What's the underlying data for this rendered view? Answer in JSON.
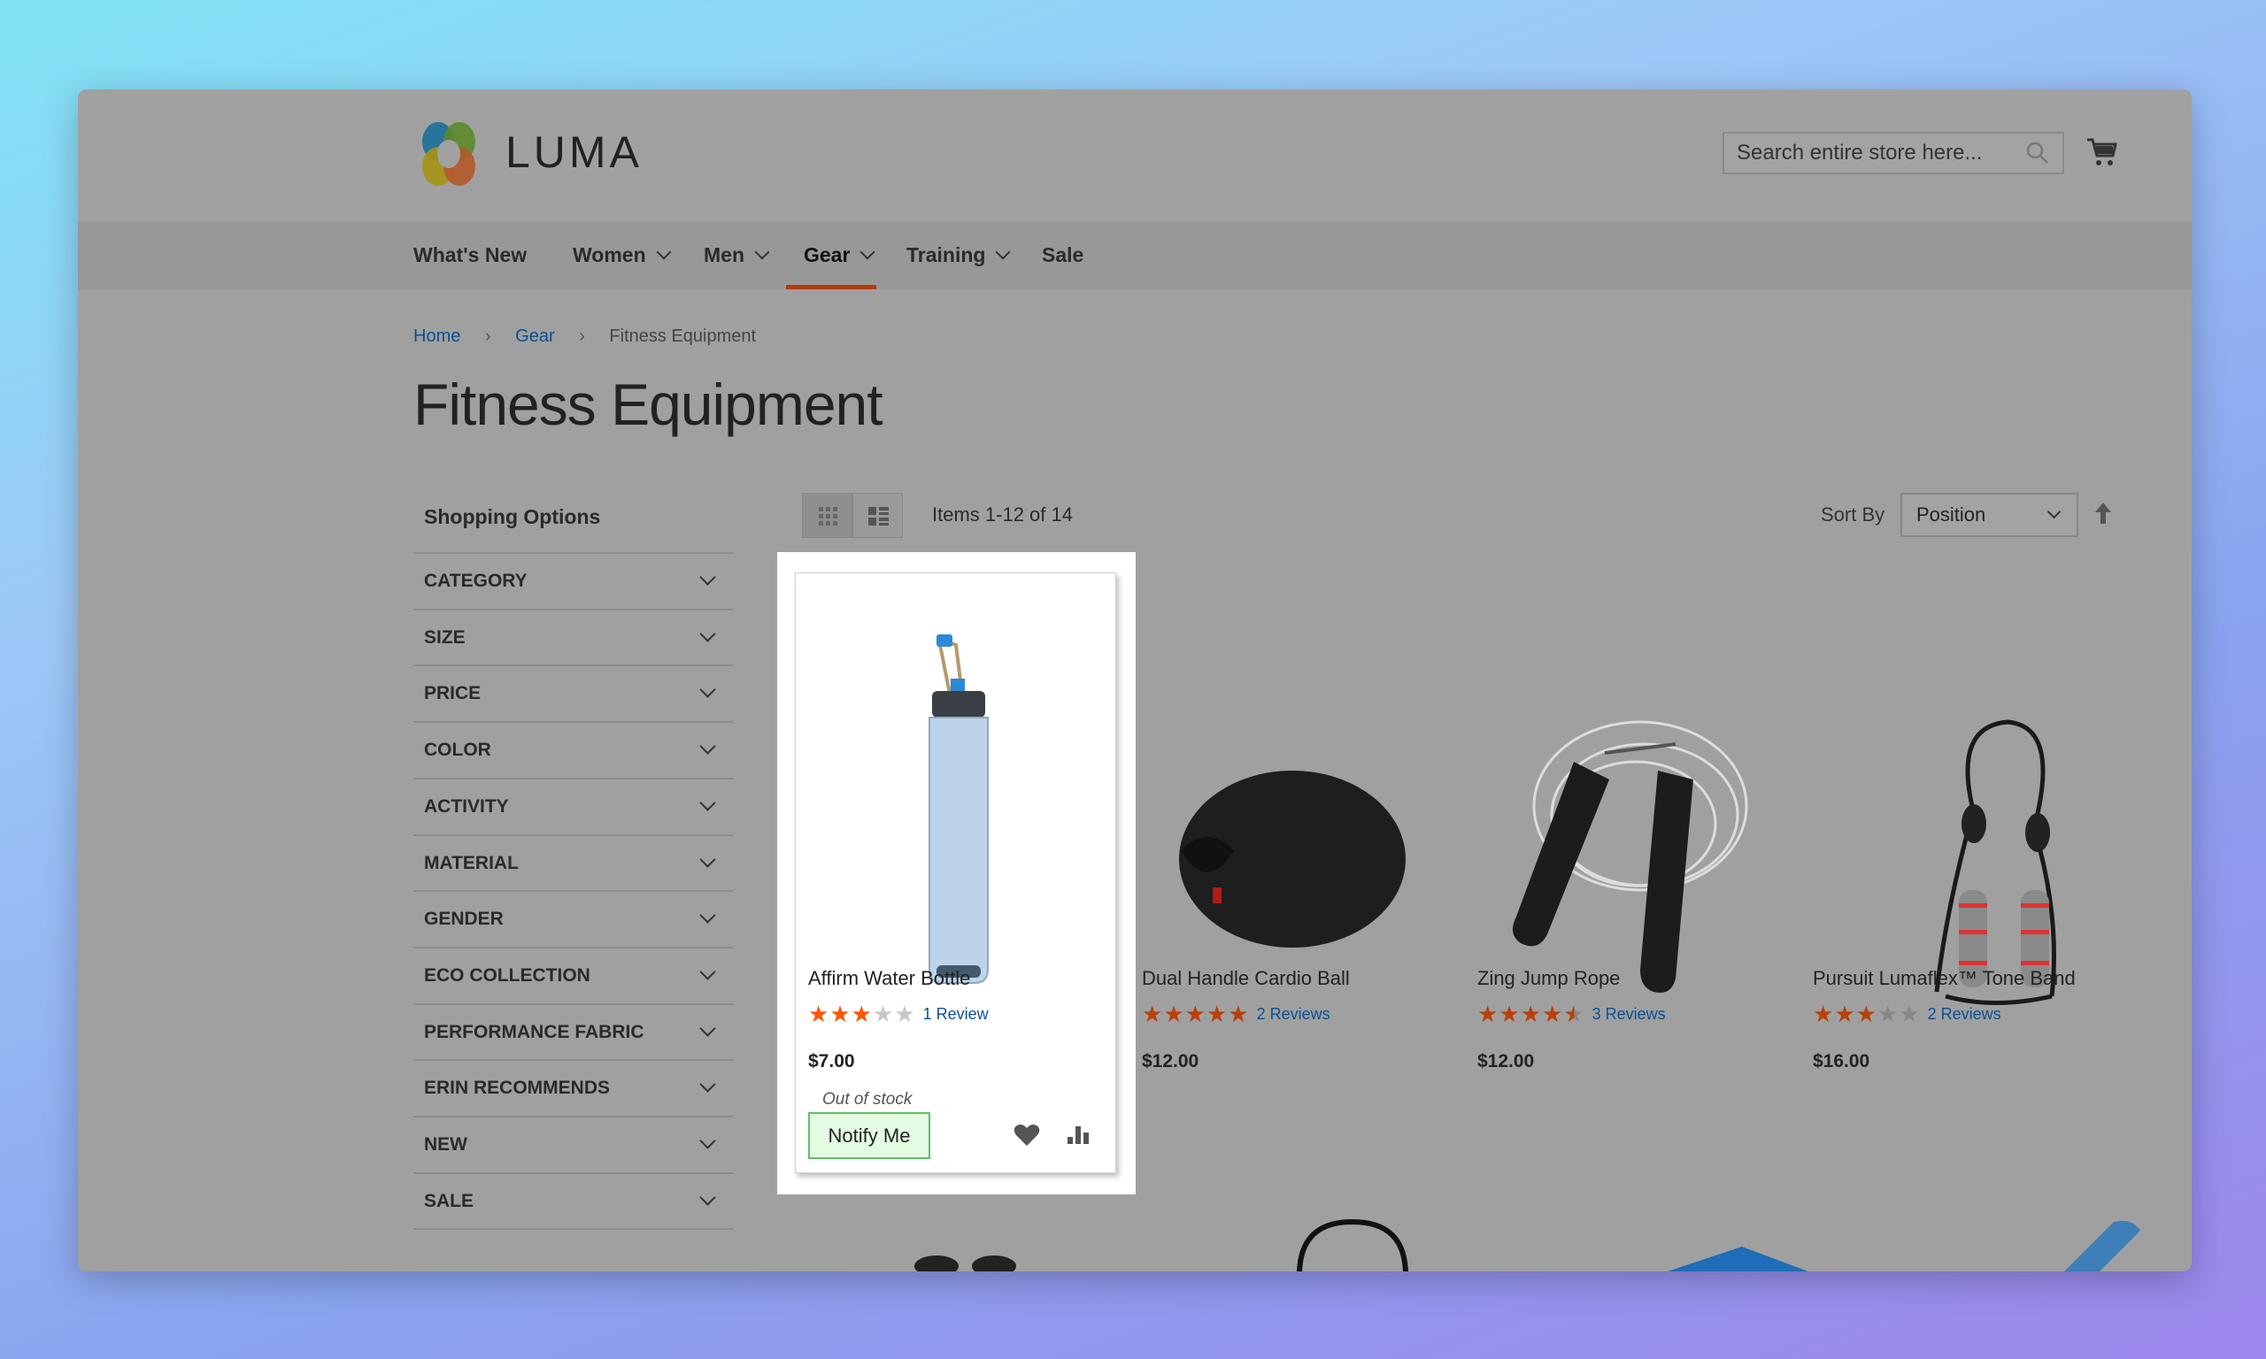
{
  "logo": {
    "text": "LUMA"
  },
  "search": {
    "placeholder": "Search entire store here..."
  },
  "nav": [
    {
      "label": "What's New",
      "dropdown": false
    },
    {
      "label": "Women",
      "dropdown": true
    },
    {
      "label": "Men",
      "dropdown": true
    },
    {
      "label": "Gear",
      "dropdown": true,
      "active": true
    },
    {
      "label": "Training",
      "dropdown": true
    },
    {
      "label": "Sale",
      "dropdown": false
    }
  ],
  "breadcrumb": {
    "home": "Home",
    "gear": "Gear",
    "current": "Fitness Equipment"
  },
  "page_title": "Fitness Equipment",
  "sidebar": {
    "heading": "Shopping Options",
    "filters": [
      "CATEGORY",
      "SIZE",
      "PRICE",
      "COLOR",
      "ACTIVITY",
      "MATERIAL",
      "GENDER",
      "ECO COLLECTION",
      "PERFORMANCE FABRIC",
      "ERIN RECOMMENDS",
      "NEW",
      "SALE"
    ]
  },
  "toolbar": {
    "items_text": "Items 1-12 of 14",
    "sort_label": "Sort By",
    "sort_value": "Position"
  },
  "products": [
    {
      "name": "Affirm Water Bottle",
      "rating": 3,
      "reviews": "1  Review",
      "price": "$7.00",
      "stock": "Out of stock",
      "action": "Notify Me"
    },
    {
      "name": "Dual Handle Cardio Ball",
      "rating": 5,
      "reviews": "2  Reviews",
      "price": "$12.00"
    },
    {
      "name": "Zing Jump Rope",
      "rating": 4.5,
      "reviews": "3  Reviews",
      "price": "$12.00"
    },
    {
      "name": "Pursuit Lumaflex™ Tone Band",
      "rating": 3,
      "reviews": "2  Reviews",
      "price": "$16.00"
    }
  ],
  "colors": {
    "accent": "#b33c0a",
    "star": "#ff5501",
    "link": "#0b4f91",
    "notify_border": "#5ec25e"
  }
}
